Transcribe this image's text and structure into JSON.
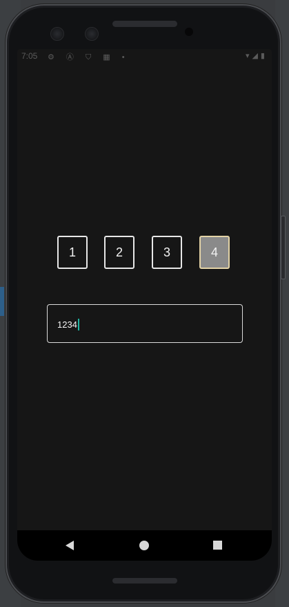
{
  "statusbar": {
    "time": "7:05",
    "left_icons": "⚙ Ⓐ ⛉ ▦ •",
    "right_icons": "▾◢▮"
  },
  "pin": {
    "digits": [
      "1",
      "2",
      "3",
      "4"
    ],
    "active_index": 3,
    "input_value": "1234"
  },
  "navbar": {
    "back_icon": "back-triangle",
    "home_icon": "home-circle",
    "recents_icon": "recents-square"
  },
  "colors": {
    "screen_bg": "#161616",
    "active_digit_bg": "#8a8a8a",
    "active_digit_border": "#e3d3a6",
    "cursor": "#1fb6a4"
  }
}
